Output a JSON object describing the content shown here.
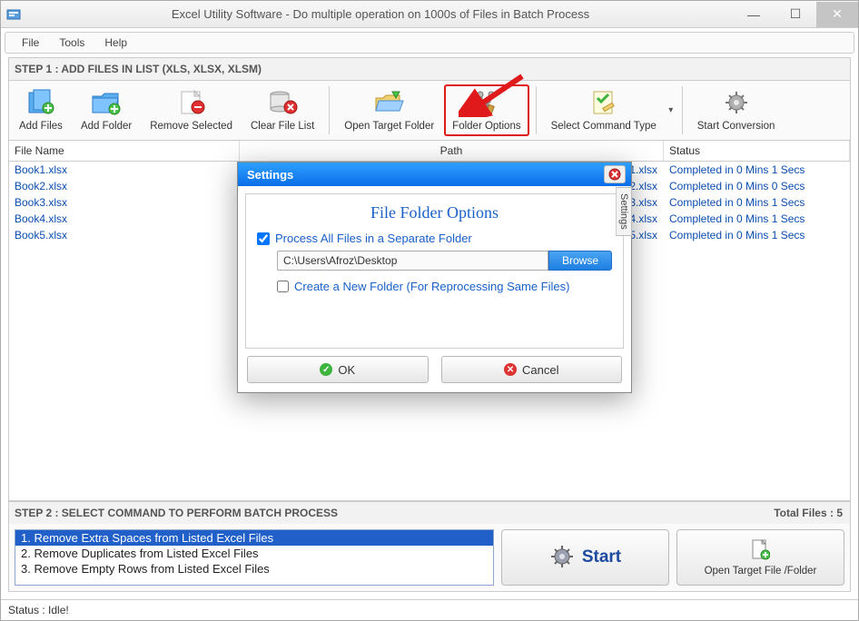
{
  "titlebar": {
    "title": "Excel Utility Software - Do multiple operation on 1000s of Files in Batch Process"
  },
  "menu": {
    "file": "File",
    "tools": "Tools",
    "help": "Help"
  },
  "step1_header": "STEP 1 : ADD FILES IN LIST (XLS, XLSX, XLSM)",
  "toolbar": {
    "add_files": "Add Files",
    "add_folder": "Add Folder",
    "remove_selected": "Remove Selected",
    "clear_list": "Clear File List",
    "open_target": "Open Target Folder",
    "folder_options": "Folder Options",
    "select_cmd": "Select Command Type",
    "start_conv": "Start Conversion"
  },
  "columns": {
    "name": "File Name",
    "path": "Path",
    "status": "Status"
  },
  "rows": [
    {
      "name": "Book1.xlsx",
      "path_tail": "k1.xlsx",
      "status": "Completed in 0 Mins 1 Secs"
    },
    {
      "name": "Book2.xlsx",
      "path_tail": "k2.xlsx",
      "status": "Completed in 0 Mins 0 Secs"
    },
    {
      "name": "Book3.xlsx",
      "path_tail": "k3.xlsx",
      "status": "Completed in 0 Mins 1 Secs"
    },
    {
      "name": "Book4.xlsx",
      "path_tail": "k4.xlsx",
      "status": "Completed in 0 Mins 1 Secs"
    },
    {
      "name": "Book5.xlsx",
      "path_tail": "k5.xlsx",
      "status": "Completed in 0 Mins 1 Secs"
    }
  ],
  "total_files": "Total Files : 5",
  "step2_header": "STEP 2 : SELECT COMMAND TO PERFORM BATCH PROCESS",
  "commands": [
    "1. Remove Extra Spaces from Listed Excel Files",
    "2. Remove Duplicates from Listed Excel Files",
    "3. Remove Empty Rows from Listed Excel Files"
  ],
  "start_label": "Start",
  "open_target_label": "Open Target File /Folder",
  "statusbar": "Status  :  Idle!",
  "dialog": {
    "title": "Settings",
    "tab": "Settings",
    "heading": "File Folder Options",
    "chk1": "Process All Files in a Separate Folder",
    "path": "C:\\Users\\Afroz\\Desktop",
    "browse": "Browse",
    "chk2": "Create a New Folder (For Reprocessing Same Files)",
    "ok": "OK",
    "cancel": "Cancel"
  }
}
